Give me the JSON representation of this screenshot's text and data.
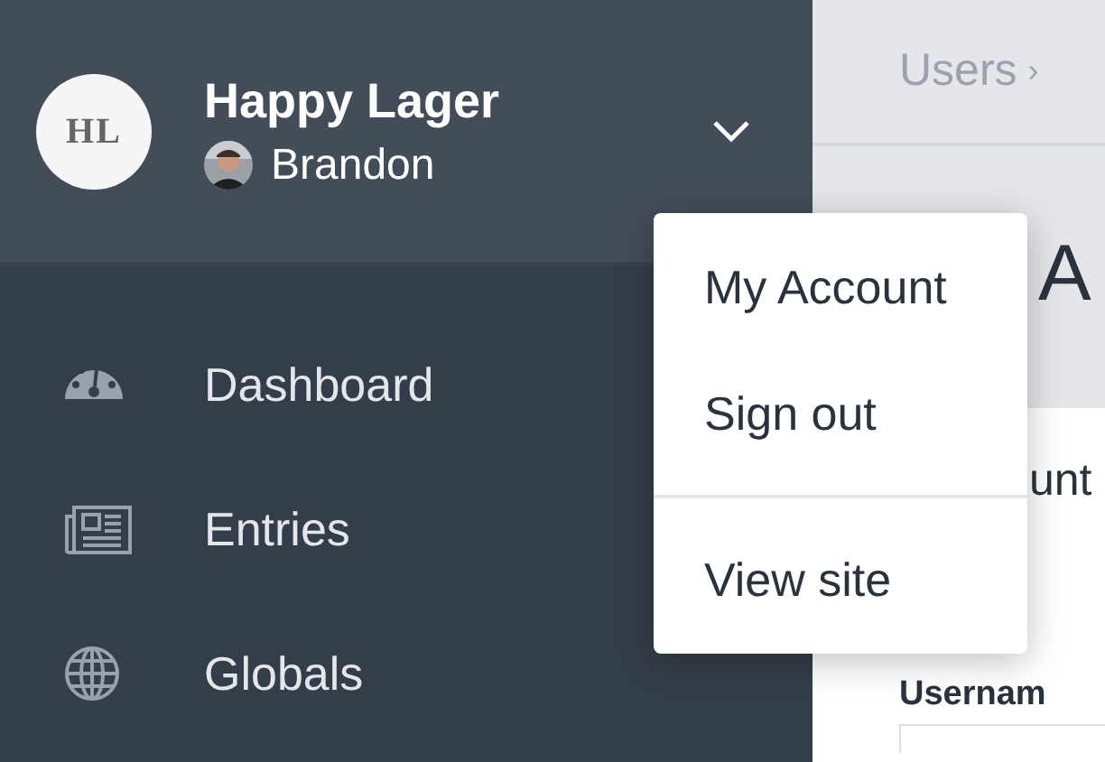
{
  "site": {
    "logo": "HL",
    "name": "Happy Lager",
    "user": "Brandon",
    "menu_expanded": true
  },
  "nav": [
    {
      "kind": "dashboard",
      "label": "Dashboard"
    },
    {
      "kind": "entries",
      "label": "Entries"
    },
    {
      "kind": "globals",
      "label": "Globals"
    }
  ],
  "breadcrumb": {
    "label": "Users",
    "separator": "›"
  },
  "page": {
    "title": "A",
    "tab": "unt",
    "field_label": "Usernam"
  },
  "menu": [
    {
      "label": "My Account",
      "divider_before": false
    },
    {
      "label": "Sign out",
      "divider_before": false
    },
    {
      "label": "View site",
      "divider_before": true
    }
  ]
}
